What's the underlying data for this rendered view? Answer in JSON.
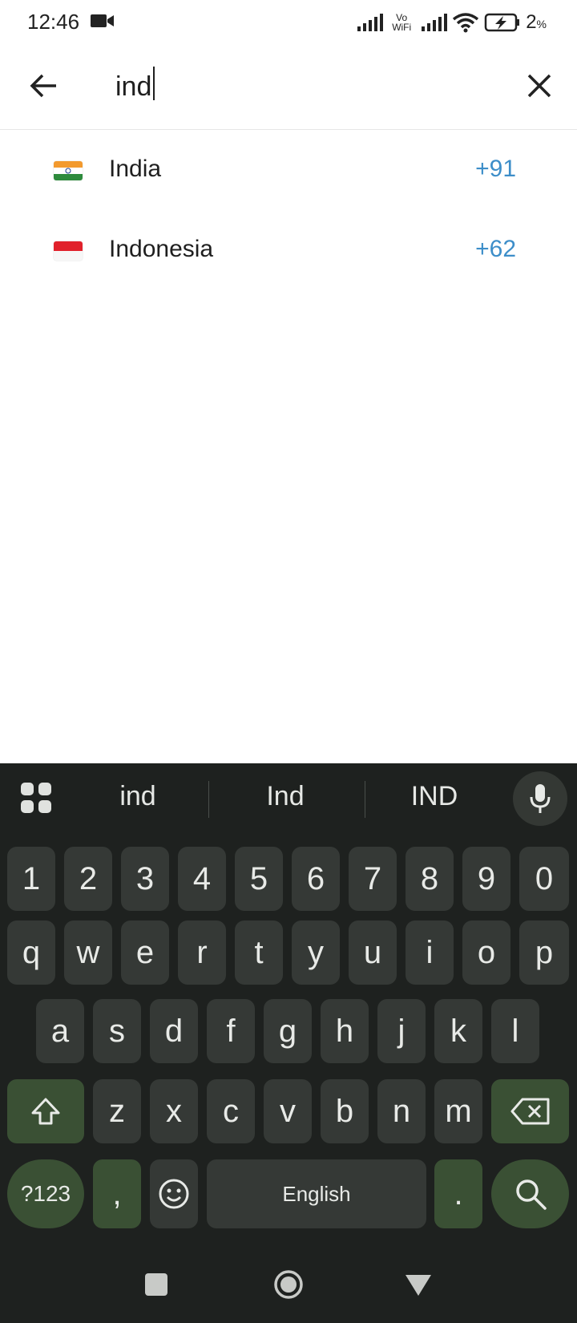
{
  "status": {
    "time": "12:46",
    "vo": "Vo",
    "wifi_label": "WiFi",
    "battery": "2",
    "battery_unit": "%"
  },
  "search": {
    "query": "ind"
  },
  "results": [
    {
      "country": "India",
      "code": "+91",
      "flag": "flag-india-icon"
    },
    {
      "country": "Indonesia",
      "code": "+62",
      "flag": "flag-indonesia-icon"
    }
  ],
  "keyboard": {
    "suggestions": [
      "ind",
      "Ind",
      "IND"
    ],
    "number_row": [
      "1",
      "2",
      "3",
      "4",
      "5",
      "6",
      "7",
      "8",
      "9",
      "0"
    ],
    "row1": [
      "q",
      "w",
      "e",
      "r",
      "t",
      "y",
      "u",
      "i",
      "o",
      "p"
    ],
    "row2": [
      "a",
      "s",
      "d",
      "f",
      "g",
      "h",
      "j",
      "k",
      "l"
    ],
    "row3": [
      "z",
      "x",
      "c",
      "v",
      "b",
      "n",
      "m"
    ],
    "symbols_label": "?123",
    "comma": ",",
    "space_label": "English",
    "period": "."
  },
  "colors": {
    "accent": "#3d8ec9",
    "keyboard_bg": "#1e211f",
    "key_bg": "#353936",
    "special_key_bg": "#3a5034"
  }
}
